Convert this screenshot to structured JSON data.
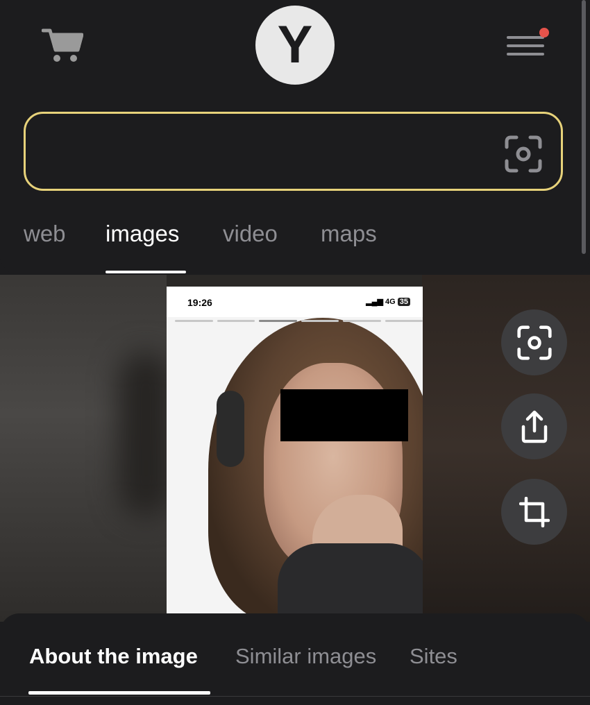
{
  "header": {
    "logo_text": "Y",
    "cart_icon": "cart-icon",
    "menu_icon": "hamburger-menu-icon",
    "notification_color": "#e5534b"
  },
  "search": {
    "value": "",
    "placeholder": "",
    "camera_icon": "camera-search-icon",
    "border_color": "#e7d27a"
  },
  "tabs": [
    {
      "label": "web",
      "active": false
    },
    {
      "label": "images",
      "active": true
    },
    {
      "label": "video",
      "active": false
    },
    {
      "label": "maps",
      "active": false
    }
  ],
  "photo": {
    "status_time": "19:26",
    "status_signal": "4G",
    "status_battery": "35"
  },
  "side_actions": [
    {
      "icon": "camera-search-icon"
    },
    {
      "icon": "share-icon"
    },
    {
      "icon": "crop-icon"
    }
  ],
  "bottom_tabs": [
    {
      "label": "About the image",
      "active": true
    },
    {
      "label": "Similar images",
      "active": false
    },
    {
      "label": "Sites",
      "active": false
    }
  ]
}
